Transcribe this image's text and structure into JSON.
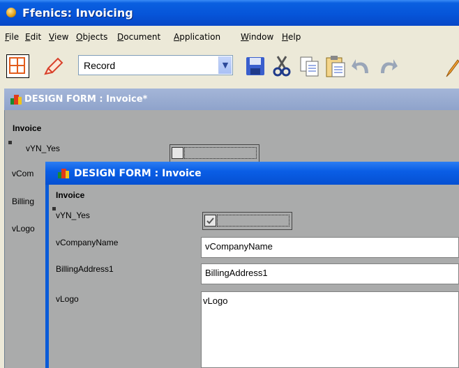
{
  "window": {
    "title": "Ffenics: Invoicing"
  },
  "menu": [
    {
      "label": "File",
      "u": "F",
      "rest": "ile"
    },
    {
      "label": "Edit",
      "u": "E",
      "rest": "dit"
    },
    {
      "label": "View",
      "u": "V",
      "rest": "iew"
    },
    {
      "label": "Objects",
      "u": "O",
      "rest": "bjects"
    },
    {
      "label": "Document",
      "u": "D",
      "rest": "ocument"
    },
    {
      "label": "Application",
      "u": "A",
      "rest": "pplication"
    },
    {
      "label": "Window",
      "u": "W",
      "rest": "indow"
    },
    {
      "label": "Help",
      "u": "H",
      "rest": "elp"
    }
  ],
  "toolbar": {
    "combo_value": "Record",
    "icons": [
      "grid-design-icon",
      "pen-draw-icon",
      "save-icon",
      "cut-icon",
      "copy-icon",
      "paste-icon",
      "undo-icon",
      "redo-icon",
      "pencil-icon"
    ]
  },
  "outer_form": {
    "title": "DESIGN FORM : Invoice*",
    "heading": "Invoice",
    "labels": [
      "vYN_Yes",
      "vCom",
      "Billing",
      "vLogo"
    ]
  },
  "inner_form": {
    "title": "DESIGN FORM : Invoice",
    "heading": "Invoice",
    "fields": {
      "yn_label": "vYN_Yes",
      "company_label": "vCompanyName",
      "company_value": "vCompanyName",
      "billing_label": "BillingAddress1",
      "billing_value": "BillingAddress1",
      "logo_label": "vLogo",
      "logo_value": "vLogo"
    }
  },
  "colors": {
    "titlebar": "#0655d9",
    "form_background": "#aaabab",
    "inactive_title": "#8fa3cb"
  }
}
